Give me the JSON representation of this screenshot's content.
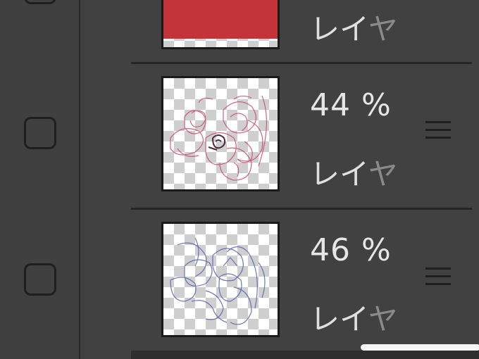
{
  "layers": [
    {
      "name": "レイヤ",
      "name_main": "レイ",
      "name_fade": "ヤ",
      "opacity_label": "",
      "fill_color": "#c2333a",
      "visible_checkbox": false
    },
    {
      "name": "レイヤ",
      "name_main": "レイ",
      "name_fade": "ヤ",
      "opacity_label": "44 %",
      "sketch_color": "#c84a6a",
      "visible_checkbox": false
    },
    {
      "name": "レイヤ",
      "name_main": "レイ",
      "name_fade": "ヤ",
      "opacity_label": "46 %",
      "sketch_color": "#5560b0",
      "visible_checkbox": false
    }
  ],
  "icons": {
    "menu": "hamburger-menu-icon",
    "checkbox": "checkbox-icon"
  },
  "colors": {
    "panel_bg": "#414141",
    "separator": "#262626",
    "text": "#e6e6e6"
  }
}
